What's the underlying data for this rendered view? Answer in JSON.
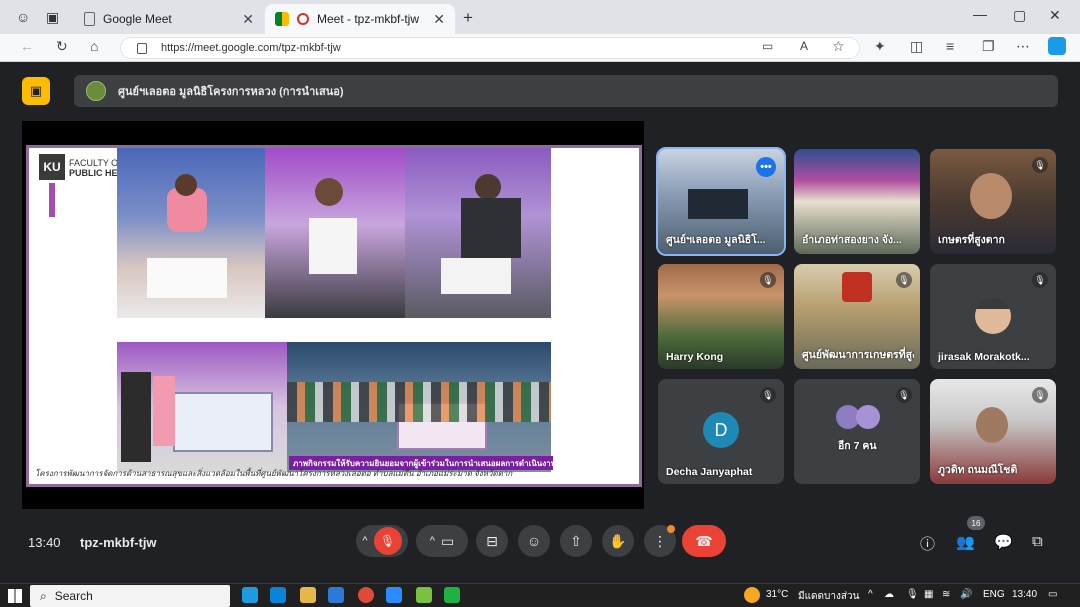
{
  "browser": {
    "tabs": [
      {
        "label": "Google Meet",
        "active": false
      },
      {
        "label": "Meet - tpz-mkbf-tjw",
        "active": true
      }
    ],
    "url": "https://meet.google.com/tpz-mkbf-tjw"
  },
  "meet": {
    "presenter_label": "ศูนย์ฯเลอตอ มูลนิธิโครงการหลวง (การนำเสนอ)",
    "slide": {
      "logo_text": "KU",
      "faculty_line1": "FACULTY OF",
      "faculty_line2": "PUBLIC HEALTH",
      "overlay_caption": "ภาพกิจกรรมให้รับความยินยอมจากผู้เข้าร่วมในการนำเสนอผลการดำเนินงาน",
      "bottom_caption": "โครงการพัฒนาการจัดการด้านสาธารณสุขและสิ่งแวดล้อมในพื้นที่ศูนย์พัฒนาโครงการหลวงเลอตอ ตำบลแม่ตื่น อำเภอแม่ระมาด จังหวัดตาก"
    },
    "tiles": [
      {
        "name": "ศูนย์ฯเลอตอ มูลนิธิโ...",
        "muted": false,
        "active": true
      },
      {
        "name": "อำเภอท่าสองยาง จัง...",
        "muted": false
      },
      {
        "name": "เกษตรที่สูงตาก",
        "muted": true
      },
      {
        "name": "Harry Kong",
        "muted": true
      },
      {
        "name": "ศูนย์พัฒนาการเกษตรที่สูง...",
        "muted": true
      },
      {
        "name": "jirasak Morakotk...",
        "muted": true
      },
      {
        "name": "Decha Janyaphat",
        "muted": true,
        "initial": "D"
      },
      {
        "name": "อีก 7 คน",
        "muted": true
      },
      {
        "name": "ภูวดิท ถนมณีโชติ",
        "muted": true
      }
    ],
    "time": "13:40",
    "meeting_code": "tpz-mkbf-tjw",
    "people_count": "16"
  },
  "taskbar": {
    "search_label": "Search",
    "weather": "31°C",
    "weather_desc": "มีแดดบางส่วน",
    "language": "ENG",
    "time": "13:40"
  },
  "colors": {
    "meet_bg": "#202124",
    "tile_bg": "#3c4043",
    "end_call": "#ea4335",
    "accent_blue": "#1a73e8",
    "slide_border": "#8e6b98"
  }
}
